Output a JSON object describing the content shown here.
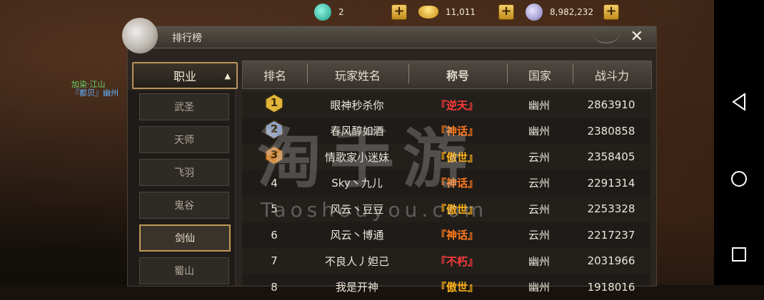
{
  "scene": {
    "banner_line1": "加染·江山",
    "banner_line2": "『都贝』幽州"
  },
  "currency": [
    {
      "icon": "jade-icon",
      "value": "2"
    },
    {
      "icon": "gold-ingot-icon",
      "value": "11,011"
    },
    {
      "icon": "silver-coin-icon",
      "value": "8,982,232"
    }
  ],
  "panel": {
    "title": "排行榜",
    "close_label": "✕"
  },
  "sidebar": {
    "header": "职业",
    "items": [
      {
        "label": "武圣",
        "active": false
      },
      {
        "label": "天师",
        "active": false
      },
      {
        "label": "飞羽",
        "active": false
      },
      {
        "label": "鬼谷",
        "active": false
      },
      {
        "label": "剑仙",
        "active": true
      },
      {
        "label": "蜀山",
        "active": false
      }
    ]
  },
  "table": {
    "headers": [
      "排名",
      "玩家姓名",
      "称号",
      "国家",
      "战斗力"
    ],
    "rows": [
      {
        "rank": "1",
        "name": "眼神秒杀你",
        "title": "『逆天』",
        "title_color": "#ff3b3b",
        "region": "幽州",
        "power": "2863910"
      },
      {
        "rank": "2",
        "name": "春风醇如酒",
        "title": "『神话』",
        "title_color": "#ff7a1a",
        "region": "幽州",
        "power": "2380858"
      },
      {
        "rank": "3",
        "name": "情歌家小迷妹",
        "title": "『傲世』",
        "title_color": "#ffb21a",
        "region": "云州",
        "power": "2358405"
      },
      {
        "rank": "4",
        "name": "Sky丶九儿",
        "title": "『神话』",
        "title_color": "#ff7a1a",
        "region": "云州",
        "power": "2291314"
      },
      {
        "rank": "5",
        "name": "风云丶豆豆",
        "title": "『傲世』",
        "title_color": "#ffb21a",
        "region": "云州",
        "power": "2253328"
      },
      {
        "rank": "6",
        "name": "风云丶博通",
        "title": "『神话』",
        "title_color": "#ff7a1a",
        "region": "云州",
        "power": "2217237"
      },
      {
        "rank": "7",
        "name": "不良人丿妲己",
        "title": "『不朽』",
        "title_color": "#ff3b3b",
        "region": "幽州",
        "power": "2031966"
      },
      {
        "rank": "8",
        "name": "我是开神",
        "title": "『傲世』",
        "title_color": "#ffb21a",
        "region": "幽州",
        "power": "1918016"
      }
    ]
  },
  "watermark": {
    "main": "淘手游",
    "sub": "Taoshouyou.com"
  },
  "colors": {
    "gold": "#c09a56",
    "medal_1": "#e0b53a",
    "medal_2": "#8f9fc0",
    "medal_3": "#d48a3c"
  }
}
